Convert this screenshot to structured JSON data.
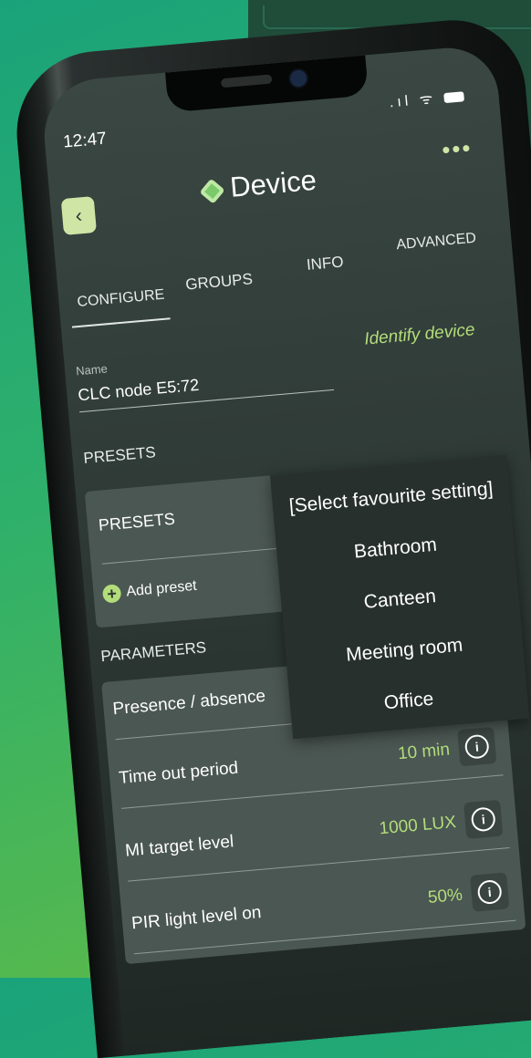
{
  "status": {
    "time": "12:47",
    "icons": ".ıl ᯤ"
  },
  "header": {
    "back_label": "‹",
    "title": "Device",
    "more_label": "•••"
  },
  "tabs": [
    {
      "label": "CONFIGURE"
    },
    {
      "label": "GROUPS"
    },
    {
      "label": "INFO"
    },
    {
      "label": "ADVANCED"
    }
  ],
  "name_field": {
    "label": "Name",
    "value": "CLC node E5:72"
  },
  "identify_label": "Identify device",
  "presets_section": {
    "heading": "PRESETS",
    "card_title": "PRESETS",
    "add_label": "Add preset",
    "add_icon": "+"
  },
  "parameters_section": {
    "heading": "PARAMETERS",
    "rows": [
      {
        "label": "Presence / absence",
        "value": ""
      },
      {
        "label": "Time out period",
        "value": "10 min"
      },
      {
        "label": "MI target level",
        "value": "1000 LUX"
      },
      {
        "label": "PIR light level on",
        "value": "50%"
      }
    ],
    "info_glyph": "i"
  },
  "dropdown": {
    "options": [
      "[Select favourite setting]",
      "Bathroom",
      "Canteen",
      "Meeting room",
      "Office"
    ]
  },
  "colors": {
    "accent": "#b3dd7a",
    "screen_bg": "#2c3733",
    "card_bg": "#4b5753"
  }
}
